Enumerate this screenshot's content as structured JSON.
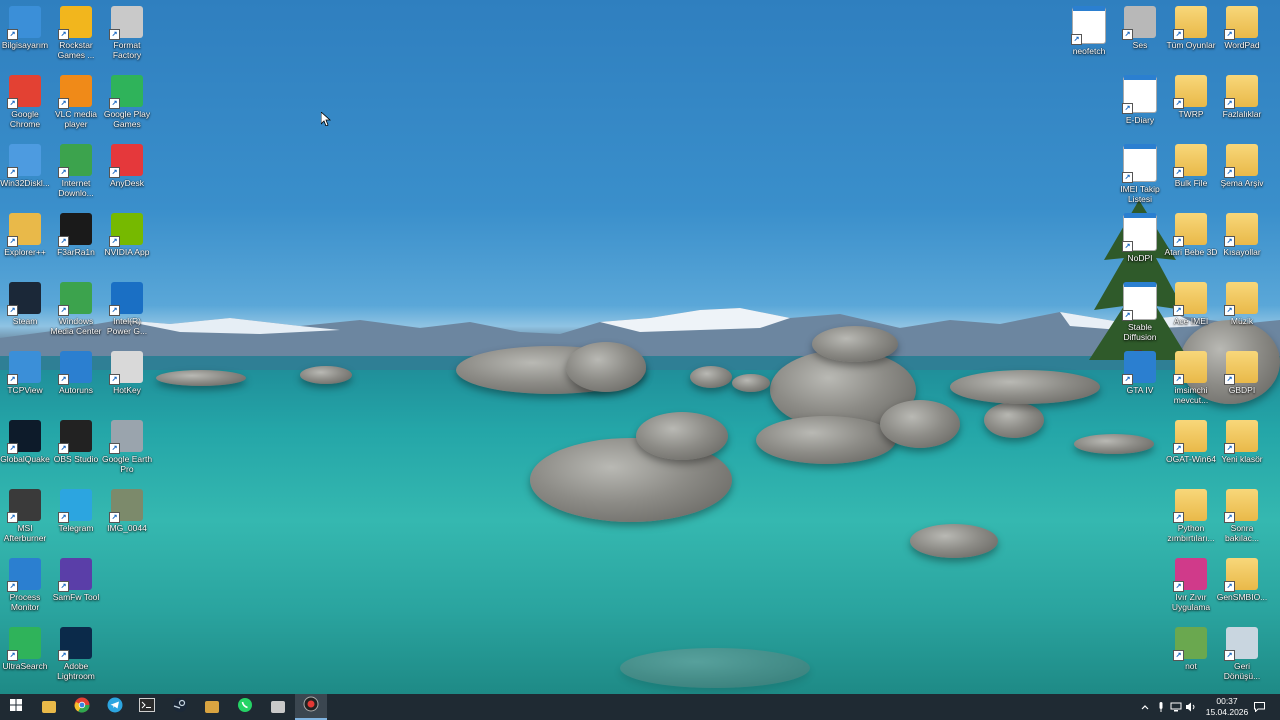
{
  "desktop": {
    "left_icons": [
      {
        "label": "Bilgisayarım",
        "icon": "computer-icon",
        "color": "#3b8fd8"
      },
      {
        "label": "Rockstar Games ...",
        "icon": "rockstar-icon",
        "color": "#f2b61d"
      },
      {
        "label": "Format Factory",
        "icon": "format-factory-icon",
        "color": "#c9c9c9"
      },
      {
        "label": "Google Chrome",
        "icon": "chrome-icon",
        "color": "#e34133"
      },
      {
        "label": "VLC media player",
        "icon": "vlc-icon",
        "color": "#f08a18"
      },
      {
        "label": "Google Play Games",
        "icon": "play-games-icon",
        "color": "#2fb35a"
      },
      {
        "label": "Win32Diskl...",
        "icon": "win32disk-icon",
        "color": "#4d9be0"
      },
      {
        "label": "Internet Downlo...",
        "icon": "idm-icon",
        "color": "#3ca34d"
      },
      {
        "label": "AnyDesk",
        "icon": "anydesk-icon",
        "color": "#e5383b"
      },
      {
        "label": "Explorer++",
        "icon": "explorer-plus-icon",
        "color": "#e9b949"
      },
      {
        "label": "F3arRa1n",
        "icon": "f3arra1n-icon",
        "color": "#1a1a1a"
      },
      {
        "label": "NVIDIA App",
        "icon": "nvidia-icon",
        "color": "#76b900"
      },
      {
        "label": "Steam",
        "icon": "steam-icon",
        "color": "#1b2838"
      },
      {
        "label": "Windows Media Center",
        "icon": "media-center-icon",
        "color": "#3ca34d"
      },
      {
        "label": "Intel(R) Power G...",
        "icon": "intel-power-icon",
        "color": "#1a6fc4"
      },
      {
        "label": "TCPView",
        "icon": "tcpview-icon",
        "color": "#3b8fd8"
      },
      {
        "label": "Autoruns",
        "icon": "autoruns-icon",
        "color": "#2b7fd0"
      },
      {
        "label": "HotKey",
        "icon": "hotkey-icon",
        "color": "#d9d9d9"
      },
      {
        "label": "GlobalQuake",
        "icon": "globalquake-icon",
        "color": "#0d1b2a"
      },
      {
        "label": "OBS Studio",
        "icon": "obs-icon",
        "color": "#222"
      },
      {
        "label": "Google Earth Pro",
        "icon": "google-earth-icon",
        "color": "#9aa4ad"
      },
      {
        "label": "MSI Afterburner",
        "icon": "afterburner-icon",
        "color": "#3a3a3a"
      },
      {
        "label": "Telegram",
        "icon": "telegram-icon",
        "color": "#2ca5e0"
      },
      {
        "label": "IMG_0044",
        "icon": "image-file-icon",
        "color": "#7c8a6b"
      },
      {
        "label": "Process Monitor",
        "icon": "process-monitor-icon",
        "color": "#2b7fd0"
      },
      {
        "label": "SamFw Tool",
        "icon": "samfw-icon",
        "color": "#5a3ea8"
      },
      {
        "label": "",
        "icon": "",
        "color": ""
      },
      {
        "label": "UltraSearch",
        "icon": "ultrasearch-icon",
        "color": "#2fb35a"
      },
      {
        "label": "Adobe Lightroom",
        "icon": "lightroom-icon",
        "color": "#0b2a4a"
      }
    ],
    "right_icons": [
      {
        "label": "neofetch",
        "icon": "neofetch-icon",
        "color": "#2b7fd0",
        "type": "doc"
      },
      {
        "label": "Ses",
        "icon": "speaker-icon",
        "color": "#b8b8b8",
        "type": "app"
      },
      {
        "label": "Tüm Oyunlar",
        "icon": "folder-icon",
        "color": "#e9b949",
        "type": "folder"
      },
      {
        "label": "WordPad",
        "icon": "folder-icon",
        "color": "#e9b949",
        "type": "folder"
      },
      {
        "label": "",
        "icon": "",
        "color": "",
        "type": "none"
      },
      {
        "label": "E-Diary",
        "icon": "text-file-icon",
        "color": "#ffffff",
        "type": "doc"
      },
      {
        "label": "TWRP",
        "icon": "folder-icon",
        "color": "#e9b949",
        "type": "folder"
      },
      {
        "label": "Fazlalıklar",
        "icon": "archive-folder-icon",
        "color": "#8b6a3a",
        "type": "folder"
      },
      {
        "label": "",
        "icon": "",
        "color": "",
        "type": "none"
      },
      {
        "label": "IMEI Takip Listesi",
        "icon": "text-file-icon",
        "color": "#ffffff",
        "type": "doc"
      },
      {
        "label": "Bulk File",
        "icon": "folder-icon",
        "color": "#e9b949",
        "type": "folder"
      },
      {
        "label": "Şema Arşiv",
        "icon": "folder-icon",
        "color": "#e9b949",
        "type": "folder"
      },
      {
        "label": "",
        "icon": "",
        "color": "",
        "type": "none"
      },
      {
        "label": "NoDPI",
        "icon": "settings-file-icon",
        "color": "#ffffff",
        "type": "doc"
      },
      {
        "label": "Atari Bebe 3D",
        "icon": "folder-icon",
        "color": "#e9b949",
        "type": "folder"
      },
      {
        "label": "Kısayollar",
        "icon": "folder-icon",
        "color": "#e9b949",
        "type": "folder"
      },
      {
        "label": "",
        "icon": "",
        "color": "",
        "type": "none"
      },
      {
        "label": "Stable Diffusion",
        "icon": "settings-file-icon",
        "color": "#ffffff",
        "type": "doc"
      },
      {
        "label": "Ace IMEI",
        "icon": "folder-icon",
        "color": "#e9b949",
        "type": "folder"
      },
      {
        "label": "Müzik",
        "icon": "music-folder-icon",
        "color": "#2b7fd0",
        "type": "folder"
      },
      {
        "label": "",
        "icon": "",
        "color": "",
        "type": "none"
      },
      {
        "label": "GTA IV",
        "icon": "gta-icon",
        "color": "#2b7fd0",
        "type": "app"
      },
      {
        "label": "imsimchi mevcut...",
        "icon": "folder-icon",
        "color": "#e9b949",
        "type": "folder"
      },
      {
        "label": "GBDPI",
        "icon": "folder-icon",
        "color": "#e9b949",
        "type": "folder"
      },
      {
        "label": "",
        "icon": "",
        "color": "",
        "type": "none"
      },
      {
        "label": "",
        "icon": "",
        "color": "",
        "type": "none"
      },
      {
        "label": "OGAT-Win64",
        "icon": "folder-icon",
        "color": "#e9b949",
        "type": "folder"
      },
      {
        "label": "Yeni klasör",
        "icon": "folder-icon",
        "color": "#e9b949",
        "type": "folder"
      },
      {
        "label": "",
        "icon": "",
        "color": "",
        "type": "none"
      },
      {
        "label": "",
        "icon": "",
        "color": "",
        "type": "none"
      },
      {
        "label": "Python zımbırtıları...",
        "icon": "folder-icon",
        "color": "#e9b949",
        "type": "folder"
      },
      {
        "label": "Sonra bakılac...",
        "icon": "folder-icon",
        "color": "#e9b949",
        "type": "folder"
      },
      {
        "label": "",
        "icon": "",
        "color": "",
        "type": "none"
      },
      {
        "label": "",
        "icon": "",
        "color": "",
        "type": "none"
      },
      {
        "label": "Ivır Zıvır Uygulama",
        "icon": "app-grid-icon",
        "color": "#d03a8a",
        "type": "app"
      },
      {
        "label": "GenSMBIO...",
        "icon": "folder-icon",
        "color": "#e9b949",
        "type": "folder"
      },
      {
        "label": "",
        "icon": "",
        "color": "",
        "type": "none"
      },
      {
        "label": "",
        "icon": "",
        "color": "",
        "type": "none"
      },
      {
        "label": "not",
        "icon": "notepad-icon",
        "color": "#6aa84f",
        "type": "app"
      },
      {
        "label": "Geri Dönüşü...",
        "icon": "recycle-bin-icon",
        "color": "#c9d6e0",
        "type": "app"
      }
    ]
  },
  "taskbar": {
    "apps": [
      {
        "name": "start-button",
        "icon": "windows-icon",
        "color": "#ffffff"
      },
      {
        "name": "taskbar-file-explorer",
        "icon": "folder-icon",
        "color": "#e9b949"
      },
      {
        "name": "taskbar-chrome",
        "icon": "chrome-icon",
        "color": "#e34133"
      },
      {
        "name": "taskbar-telegram",
        "icon": "telegram-icon",
        "color": "#2ca5e0"
      },
      {
        "name": "taskbar-terminal",
        "icon": "terminal-icon",
        "color": "#cfcfcf"
      },
      {
        "name": "taskbar-steam",
        "icon": "steam-icon",
        "color": "#c7d5e0"
      },
      {
        "name": "taskbar-media",
        "icon": "media-icon",
        "color": "#d9a441"
      },
      {
        "name": "taskbar-whatsapp",
        "icon": "whatsapp-icon",
        "color": "#25d366"
      },
      {
        "name": "taskbar-tool",
        "icon": "file-tool-icon",
        "color": "#c9c9c9"
      },
      {
        "name": "taskbar-recorder",
        "icon": "record-icon",
        "color": "#e53935"
      }
    ],
    "tray": {
      "clock_time": "00:37",
      "clock_date": "15.04.2026"
    }
  }
}
